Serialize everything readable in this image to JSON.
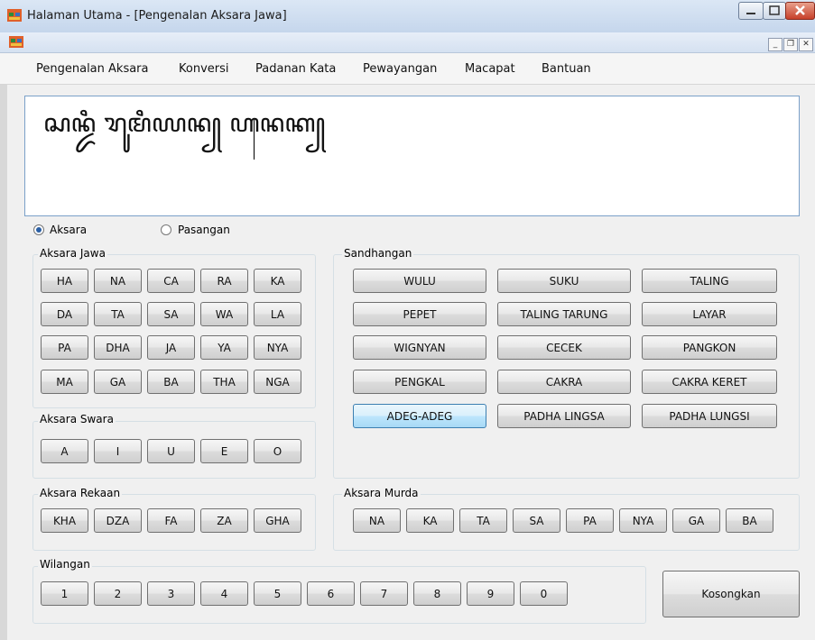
{
  "window": {
    "title": "Halaman Utama - [Pengenalan Aksara Jawa]"
  },
  "menu": [
    "Pengenalan Aksara",
    "Konversi",
    "Padanan Kata",
    "Pewayangan",
    "Macapat",
    "Bantuan"
  ],
  "mdi_controls": {
    "minimize": "_",
    "restore": "❐",
    "close": "✕"
  },
  "textbox": {
    "value": "ꦱꦤ꧀ꦢꦶ ꦫꦸꦩꦶꦪꦤ꧀ ꦲꦤꦏ꧀"
  },
  "mode": {
    "aksara": "Aksara",
    "pasangan": "Pasangan",
    "selected": "Aksara"
  },
  "groups": {
    "aksara_jawa": {
      "label": "Aksara Jawa",
      "buttons": [
        "HA",
        "NA",
        "CA",
        "RA",
        "KA",
        "DA",
        "TA",
        "SA",
        "WA",
        "LA",
        "PA",
        "DHA",
        "JA",
        "YA",
        "NYA",
        "MA",
        "GA",
        "BA",
        "THA",
        "NGA"
      ]
    },
    "sandhangan": {
      "label": "Sandhangan",
      "buttons": [
        "WULU",
        "SUKU",
        "TALING",
        "PEPET",
        "TALING TARUNG",
        "LAYAR",
        "WIGNYAN",
        "CECEK",
        "PANGKON",
        "PENGKAL",
        "CAKRA",
        "CAKRA KERET",
        "ADEG-ADEG",
        "PADHA LINGSA",
        "PADHA LUNGSI"
      ],
      "highlighted": "ADEG-ADEG"
    },
    "aksara_swara": {
      "label": "Aksara Swara",
      "buttons": [
        "A",
        "I",
        "U",
        "E",
        "O"
      ]
    },
    "aksara_rekaan": {
      "label": "Aksara Rekaan",
      "buttons": [
        "KHA",
        "DZA",
        "FA",
        "ZA",
        "GHA"
      ]
    },
    "aksara_murda": {
      "label": "Aksara Murda",
      "buttons": [
        "NA",
        "KA",
        "TA",
        "SA",
        "PA",
        "NYA",
        "GA",
        "BA"
      ]
    },
    "wilangan": {
      "label": "Wilangan",
      "buttons": [
        "1",
        "2",
        "3",
        "4",
        "5",
        "6",
        "7",
        "8",
        "9",
        "0"
      ]
    }
  },
  "clear_button": "Kosongkan",
  "colors": {
    "accent": "#3c7fb1",
    "titlebar": "#c5d6ec",
    "close": "#c7402a"
  }
}
